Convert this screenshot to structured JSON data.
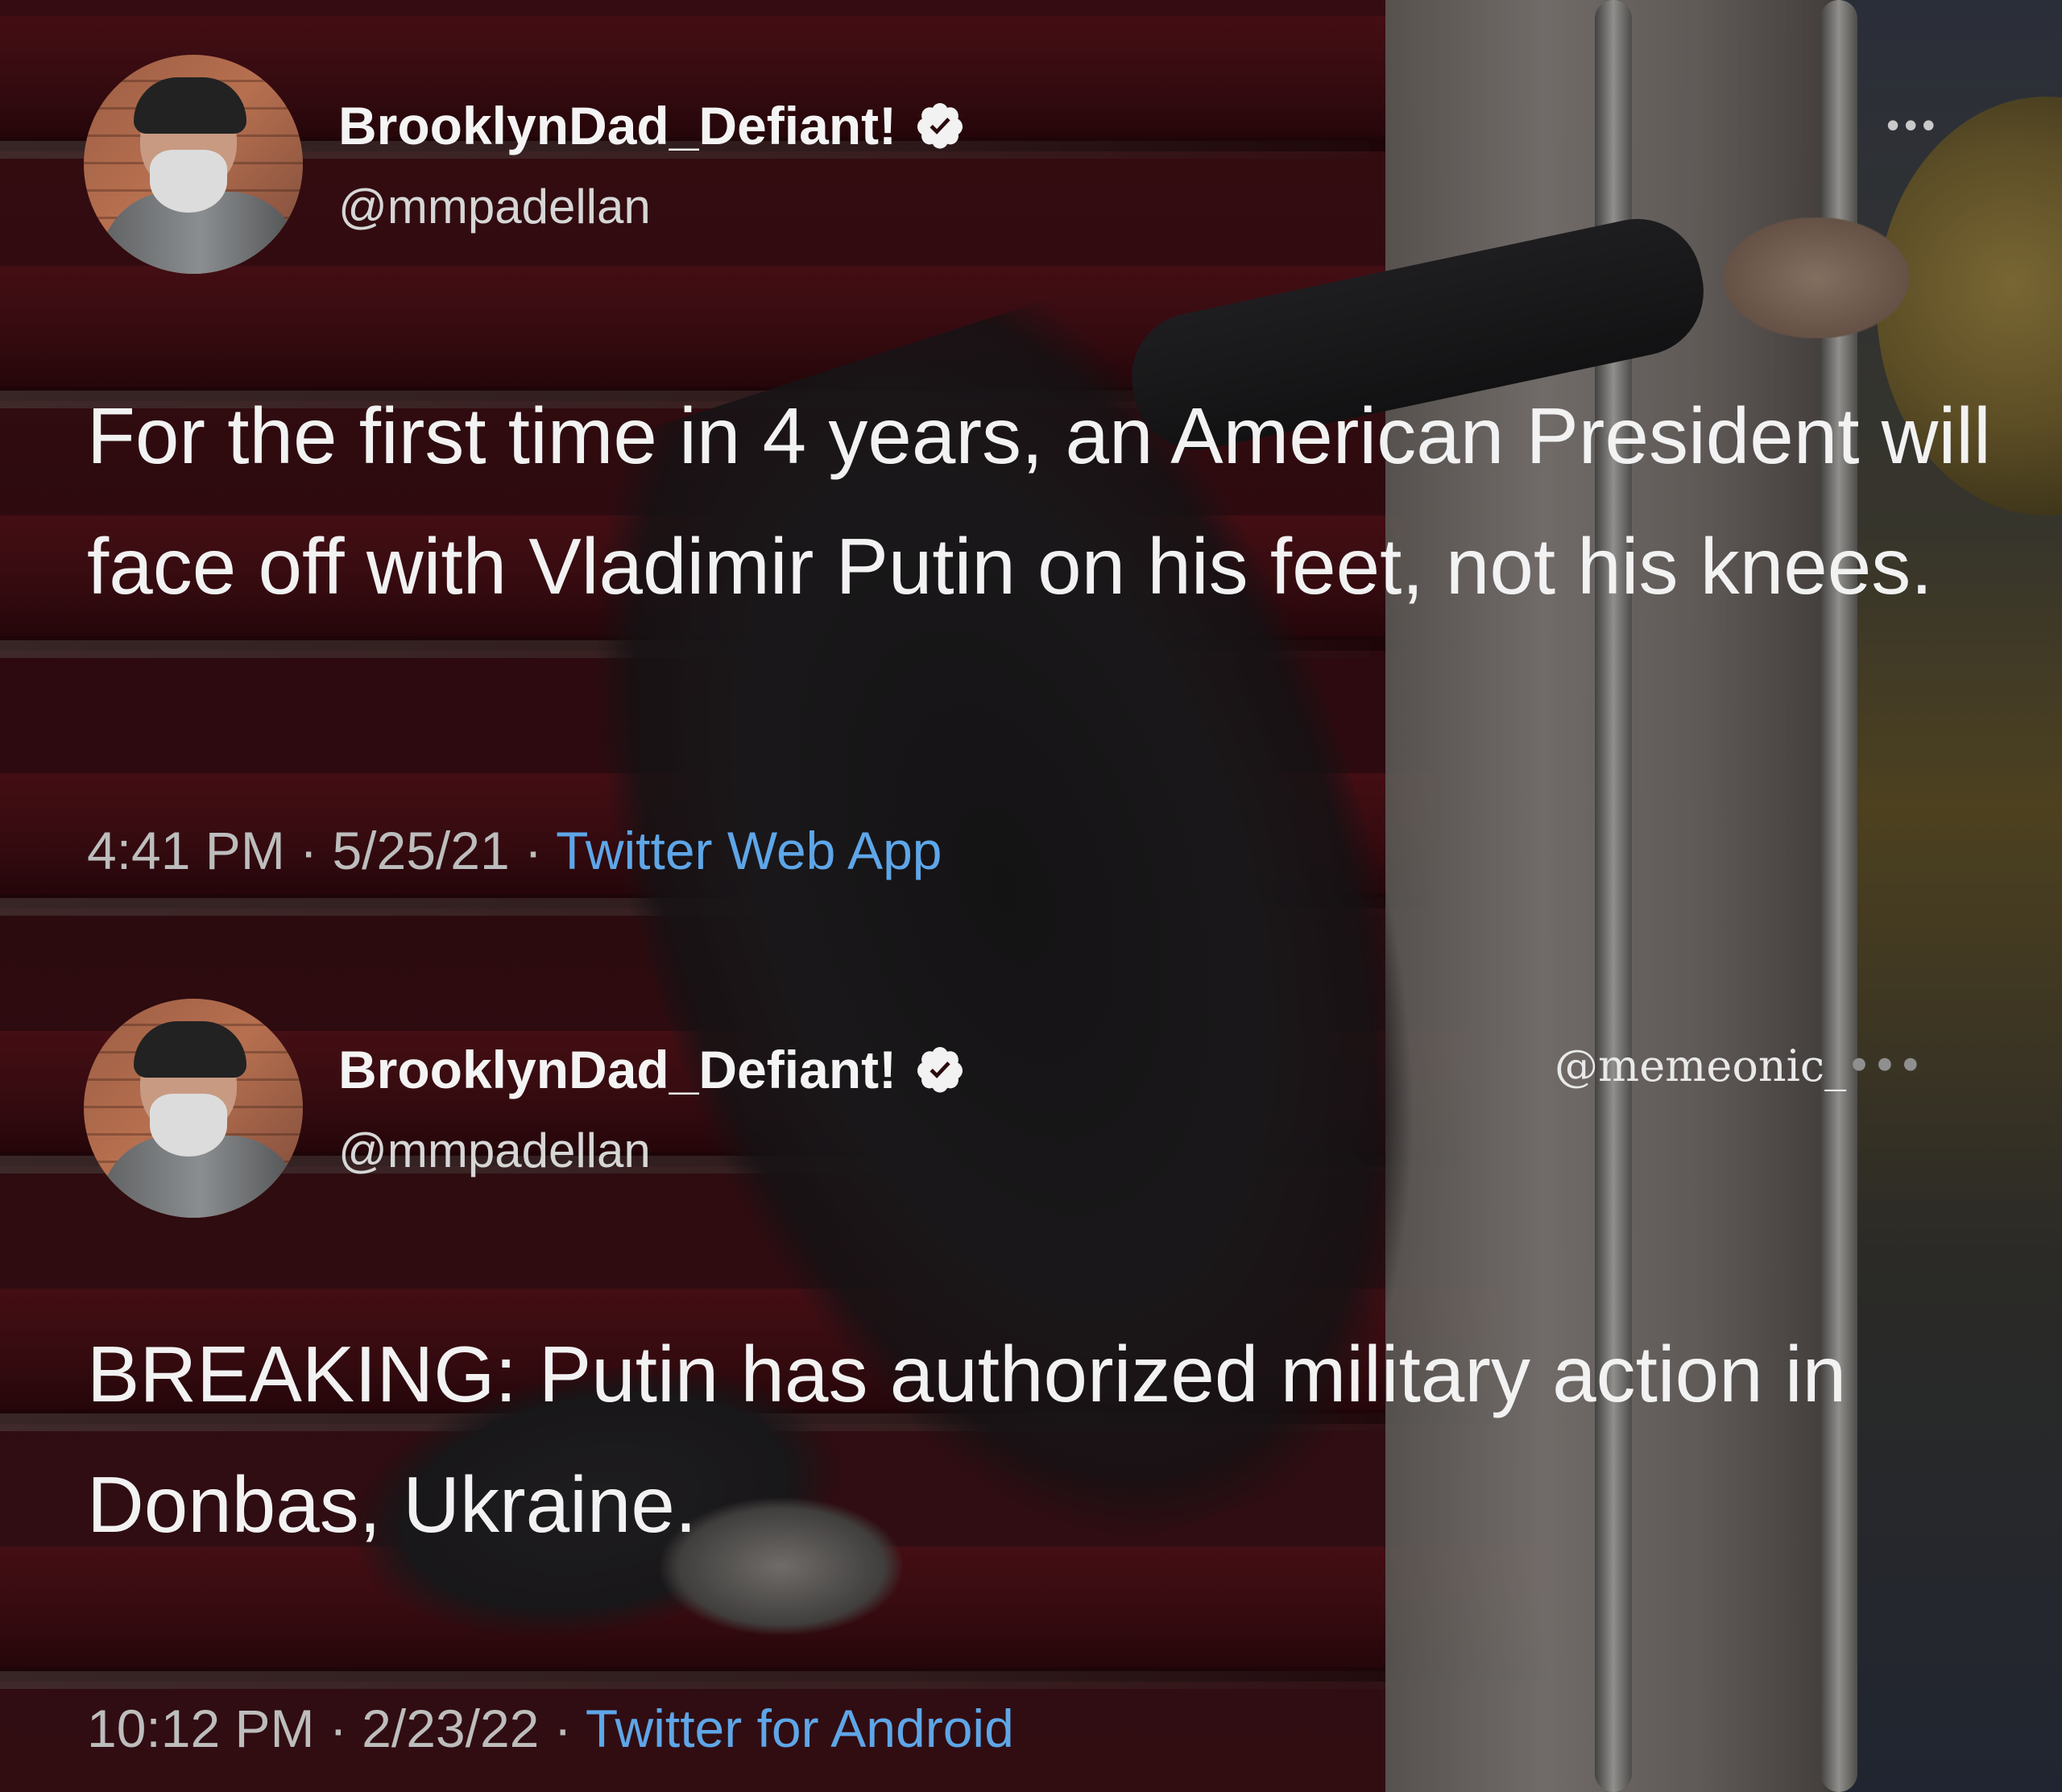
{
  "tweets": [
    {
      "display_name": "BrooklynDad_Defiant!",
      "handle": "@mmpadellan",
      "verified": true,
      "more_menu": "•••",
      "text": "For the first time in 4 years, an American President will face off with Vladimir Putin on his feet, not his knees.",
      "time": "4:41 PM",
      "date": "5/25/21",
      "separator": "·",
      "source": "Twitter Web App"
    },
    {
      "display_name": "BrooklynDad_Defiant!",
      "handle": "@mmpadellan",
      "verified": true,
      "text": "BREAKING: Putin has authorized military action in Donbas, Ukraine.",
      "time": "10:12 PM",
      "date": "2/23/22",
      "separator": "·",
      "source": "Twitter for Android"
    }
  ],
  "watermark": {
    "text": "@memeonic_",
    "trail": "•••"
  },
  "colors": {
    "text": "#f2f2f2",
    "handle": "#d6d6d6",
    "meta": "#bdbdbd",
    "source_link": "#5ea6e8",
    "background_carpet": "#4b1017"
  },
  "icons": {
    "verified": "verified-badge-icon",
    "more": "more-options-icon"
  }
}
